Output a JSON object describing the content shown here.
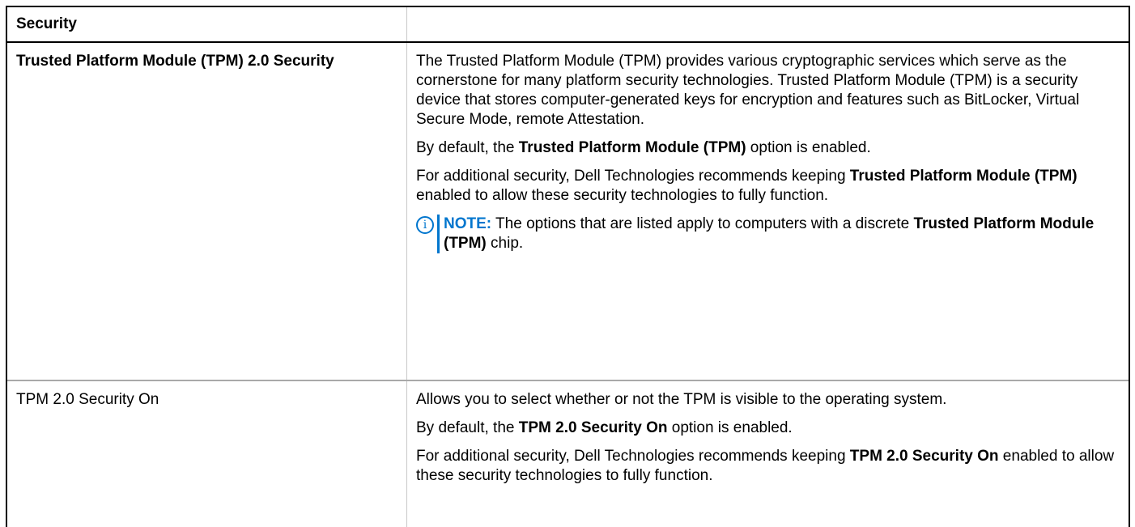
{
  "table": {
    "header": "Security",
    "rows": [
      {
        "option": "Trusted Platform Module (TPM) 2.0 Security",
        "p1": "The Trusted Platform Module (TPM) provides various cryptographic services which serve as the cornerstone for many platform security technologies. Trusted Platform Module (TPM) is a security device that stores computer-generated keys for encryption and features such as BitLocker, Virtual Secure Mode, remote Attestation.",
        "p2_pre": "By default, the ",
        "p2_bold": "Trusted Platform Module (TPM)",
        "p2_post": " option is enabled.",
        "p3_pre": "For additional security, Dell Technologies recommends keeping ",
        "p3_bold": "Trusted Platform Module (TPM)",
        "p3_post": " enabled to allow these security technologies to fully function.",
        "note_label": "NOTE:",
        "note_pre": " The options that are listed apply to computers with a discrete ",
        "note_bold": "Trusted Platform Module (TPM)",
        "note_post": " chip."
      },
      {
        "option": "TPM 2.0 Security On",
        "p1": "Allows you to select whether or not the TPM is visible to the operating system.",
        "p2_pre": "By default, the ",
        "p2_bold": "TPM 2.0 Security On",
        "p2_post": " option is enabled.",
        "p3_pre": "For additional security, Dell Technologies recommends keeping ",
        "p3_bold": "TPM 2.0 Security On",
        "p3_post": " enabled to allow these security technologies to fully function."
      }
    ]
  },
  "icons": {
    "note": "info-icon",
    "note_glyph": "i"
  },
  "colors": {
    "accent": "#0076ce"
  }
}
